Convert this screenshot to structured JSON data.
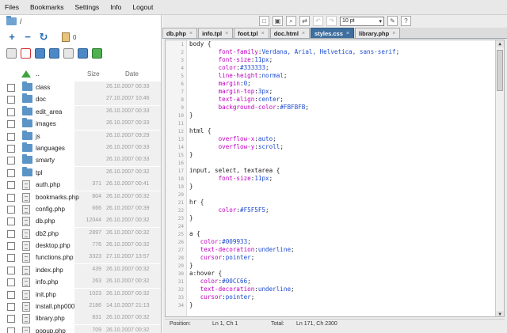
{
  "menu": {
    "items": [
      "Files",
      "Bookmarks",
      "Settings",
      "Info",
      "Logout"
    ]
  },
  "path": {
    "text": "/"
  },
  "clipboard": {
    "count": "0"
  },
  "list": {
    "up_label": "..",
    "size_header": "Size",
    "date_header": "Date",
    "rows": [
      {
        "name": "class",
        "type": "folder",
        "size": "",
        "date": "26.10.2007 00:33"
      },
      {
        "name": "doc",
        "type": "folder",
        "size": "",
        "date": "27.10.2007 10:46"
      },
      {
        "name": "edit_area",
        "type": "folder",
        "size": "",
        "date": "26.10.2007 00:33"
      },
      {
        "name": "images",
        "type": "folder",
        "size": "",
        "date": "26.10.2007 00:33"
      },
      {
        "name": "js",
        "type": "folder",
        "size": "",
        "date": "26.10.2007 09:29"
      },
      {
        "name": "languages",
        "type": "folder",
        "size": "",
        "date": "26.10.2007 00:33"
      },
      {
        "name": "smarty",
        "type": "folder",
        "size": "",
        "date": "26.10.2007 00:33"
      },
      {
        "name": "tpl",
        "type": "folder",
        "size": "",
        "date": "26.10.2007 00:32"
      },
      {
        "name": "auth.php",
        "type": "file",
        "size": "371",
        "date": "26.10.2007 00:41"
      },
      {
        "name": "bookmarks.php",
        "type": "file",
        "size": "804",
        "date": "26.10.2007 00:32"
      },
      {
        "name": "config.php",
        "type": "file",
        "size": "666",
        "date": "26.10.2007 00:39"
      },
      {
        "name": "db.php",
        "type": "file",
        "size": "12044",
        "date": "26.10.2007 00:32"
      },
      {
        "name": "db2.php",
        "type": "file",
        "size": "2897",
        "date": "26.10.2007 00:32"
      },
      {
        "name": "desktop.php",
        "type": "file",
        "size": "776",
        "date": "26.10.2007 00:32"
      },
      {
        "name": "functions.php",
        "type": "file",
        "size": "3323",
        "date": "27.10.2007 13:57"
      },
      {
        "name": "index.php",
        "type": "file",
        "size": "439",
        "date": "26.10.2007 00:32"
      },
      {
        "name": "info.php",
        "type": "file",
        "size": "263",
        "date": "26.10.2007 00:32"
      },
      {
        "name": "init.php",
        "type": "file",
        "size": "1023",
        "date": "26.10.2007 00:32"
      },
      {
        "name": "install.php000",
        "type": "file",
        "size": "2186",
        "date": "14.10.2007 21:13"
      },
      {
        "name": "library.php",
        "type": "file",
        "size": "831",
        "date": "26.10.2007 00:32"
      },
      {
        "name": "popup.php",
        "type": "file",
        "size": "709",
        "date": "26.10.2007 00:32"
      }
    ]
  },
  "editor": {
    "font_size": "10 pt",
    "tabs": [
      {
        "label": "db.php",
        "active": false
      },
      {
        "label": "info.tpl",
        "active": false
      },
      {
        "label": "foot.tpl",
        "active": false
      },
      {
        "label": "doc.html",
        "active": false
      },
      {
        "label": "styles.css",
        "active": true
      },
      {
        "label": "library.php",
        "active": false
      }
    ],
    "lines": [
      {
        "n": "1",
        "t": [
          [
            "",
            "body {"
          ]
        ]
      },
      {
        "n": "2",
        "t": [
          [
            "",
            "        "
          ],
          [
            "p",
            "font-family"
          ],
          [
            "",
            ":"
          ],
          [
            "v",
            "Verdana, Arial, Helvetica, sans-serif"
          ],
          [
            "",
            ";"
          ]
        ]
      },
      {
        "n": "3",
        "t": [
          [
            "",
            "        "
          ],
          [
            "p",
            "font-size"
          ],
          [
            "",
            ":"
          ],
          [
            "v",
            "11px"
          ],
          [
            "",
            ";"
          ]
        ]
      },
      {
        "n": "4",
        "t": [
          [
            "",
            "        "
          ],
          [
            "p",
            "color"
          ],
          [
            "",
            ":"
          ],
          [
            "v",
            "#333333"
          ],
          [
            "",
            ";"
          ]
        ]
      },
      {
        "n": "5",
        "t": [
          [
            "",
            "        "
          ],
          [
            "p",
            "line-height"
          ],
          [
            "",
            ":"
          ],
          [
            "v",
            "normal"
          ],
          [
            "",
            ";"
          ]
        ]
      },
      {
        "n": "6",
        "t": [
          [
            "",
            "        "
          ],
          [
            "p",
            "margin"
          ],
          [
            "",
            ":"
          ],
          [
            "v",
            "0"
          ],
          [
            "",
            ";"
          ]
        ]
      },
      {
        "n": "7",
        "t": [
          [
            "",
            "        "
          ],
          [
            "p",
            "margin-top"
          ],
          [
            "",
            ":"
          ],
          [
            "v",
            "3px"
          ],
          [
            "",
            ";"
          ]
        ]
      },
      {
        "n": "8",
        "t": [
          [
            "",
            "        "
          ],
          [
            "p",
            "text-align"
          ],
          [
            "",
            ":"
          ],
          [
            "v",
            "center"
          ],
          [
            "",
            ";"
          ]
        ]
      },
      {
        "n": "9",
        "t": [
          [
            "",
            "        "
          ],
          [
            "p",
            "background-color"
          ],
          [
            "",
            ":"
          ],
          [
            "v",
            "#FBFBFB"
          ],
          [
            "",
            ";"
          ]
        ]
      },
      {
        "n": "10",
        "t": [
          [
            "",
            "}"
          ]
        ]
      },
      {
        "n": "11",
        "t": [
          [
            "",
            ""
          ]
        ]
      },
      {
        "n": "12",
        "t": [
          [
            "",
            "html {"
          ]
        ]
      },
      {
        "n": "13",
        "t": [
          [
            "",
            "        "
          ],
          [
            "p",
            "overflow-x"
          ],
          [
            "",
            ":"
          ],
          [
            "v",
            "auto"
          ],
          [
            "",
            ";"
          ]
        ]
      },
      {
        "n": "14",
        "t": [
          [
            "",
            "        "
          ],
          [
            "p",
            "overflow-y"
          ],
          [
            "",
            ":"
          ],
          [
            "v",
            "scroll"
          ],
          [
            "",
            ";"
          ]
        ]
      },
      {
        "n": "15",
        "t": [
          [
            "",
            "}"
          ]
        ]
      },
      {
        "n": "16",
        "t": [
          [
            "",
            ""
          ]
        ]
      },
      {
        "n": "17",
        "t": [
          [
            "",
            "input, select, textarea {"
          ]
        ]
      },
      {
        "n": "18",
        "t": [
          [
            "",
            "        "
          ],
          [
            "p",
            "font-size"
          ],
          [
            "",
            ":"
          ],
          [
            "v",
            "11px"
          ],
          [
            "",
            ";"
          ]
        ]
      },
      {
        "n": "19",
        "t": [
          [
            "",
            "}"
          ]
        ]
      },
      {
        "n": "20",
        "t": [
          [
            "",
            ""
          ]
        ]
      },
      {
        "n": "21",
        "t": [
          [
            "",
            "hr {"
          ]
        ]
      },
      {
        "n": "22",
        "t": [
          [
            "",
            "        "
          ],
          [
            "p",
            "color"
          ],
          [
            "",
            ":"
          ],
          [
            "v",
            "#F5F5F5"
          ],
          [
            "",
            ";"
          ]
        ]
      },
      {
        "n": "23",
        "t": [
          [
            "",
            "}"
          ]
        ]
      },
      {
        "n": "24",
        "t": [
          [
            "",
            ""
          ]
        ]
      },
      {
        "n": "25",
        "t": [
          [
            "",
            "a {"
          ]
        ]
      },
      {
        "n": "26",
        "t": [
          [
            "",
            "   "
          ],
          [
            "p",
            "color"
          ],
          [
            "",
            ":"
          ],
          [
            "v",
            "#009933"
          ],
          [
            "",
            ";"
          ]
        ]
      },
      {
        "n": "27",
        "t": [
          [
            "",
            "   "
          ],
          [
            "p",
            "text-decoration"
          ],
          [
            "",
            ":"
          ],
          [
            "v",
            "underline"
          ],
          [
            "",
            ";"
          ]
        ]
      },
      {
        "n": "28",
        "t": [
          [
            "",
            "   "
          ],
          [
            "p",
            "cursor"
          ],
          [
            "",
            ":"
          ],
          [
            "v",
            "pointer"
          ],
          [
            "",
            ";"
          ]
        ]
      },
      {
        "n": "29",
        "t": [
          [
            "",
            "}"
          ]
        ]
      },
      {
        "n": "30",
        "t": [
          [
            "",
            "a:hover {"
          ]
        ]
      },
      {
        "n": "31",
        "t": [
          [
            "",
            "   "
          ],
          [
            "p",
            "color"
          ],
          [
            "",
            ":"
          ],
          [
            "v",
            "#00CC66"
          ],
          [
            "",
            ";"
          ]
        ]
      },
      {
        "n": "32",
        "t": [
          [
            "",
            "   "
          ],
          [
            "p",
            "text-decoration"
          ],
          [
            "",
            ":"
          ],
          [
            "v",
            "underline"
          ],
          [
            "",
            ";"
          ]
        ]
      },
      {
        "n": "33",
        "t": [
          [
            "",
            "   "
          ],
          [
            "p",
            "cursor"
          ],
          [
            "",
            ":"
          ],
          [
            "v",
            "pointer"
          ],
          [
            "",
            ";"
          ]
        ]
      },
      {
        "n": "34",
        "t": [
          [
            "",
            "}"
          ]
        ]
      }
    ]
  },
  "status": {
    "position_label": "Position:",
    "position_value": "Ln 1, Ch 1",
    "total_label": "Total:",
    "total_value": "Ln 171, Ch 2300"
  }
}
